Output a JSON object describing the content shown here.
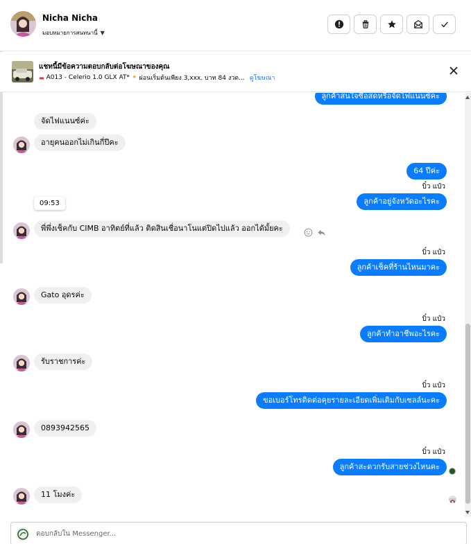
{
  "header": {
    "contact_name": "Nicha Nicha",
    "assign_label": "มอบหมายการสนทนานี้",
    "actions": [
      "report-icon",
      "trash-icon",
      "star-icon",
      "mark-unread-icon",
      "done-check-icon"
    ]
  },
  "ad_banner": {
    "title": "แชทนี้มีข้อความตอบกลับต่อโฆษณาของคุณ",
    "description": "A013 - Celerio 1.0 GLX AT* ",
    "description_after": "ผ่อนเริ่มต้นเพียง 3,xxx. บาท 84 งวด...",
    "link": "ดูโฆษณา"
  },
  "conversation": {
    "messages": [
      {
        "dir": "out",
        "text": "ลูกค้าสนใจซื้อสดหรือจัดไฟแนนซ์คะ"
      },
      {
        "dir": "in",
        "text": "จัดไฟแนนซ์ค่ะ"
      },
      {
        "dir": "in",
        "text": "อายุคนออกไม่เกินกี่ปีคะ"
      },
      {
        "dir": "out",
        "text": "64 ปีค่ะ"
      },
      {
        "dir": "out",
        "text": "ลูกค้าอยู่จังหวัดอะไรคะ",
        "seen": "บิ๋ว แป๋ว"
      },
      {
        "dir": "in",
        "text": "พี่พึ่งเช็คกับ CIMB อาทิตย์ที่แล้ว ติดสินเชื่อนาโนแต่ปิดไปแล้ว ออกได้มั้ยคะ"
      },
      {
        "dir": "out",
        "text": "ลูกค้าเช็คที่ร้านไหนมาคะ",
        "seen": "บิ๋ว แป๋ว"
      },
      {
        "dir": "in",
        "text": "Gato อุดรค่ะ"
      },
      {
        "dir": "out",
        "text": "ลูกค้าทำอาชีพอะไรคะ",
        "seen": "บิ๋ว แป๋ว"
      },
      {
        "dir": "in",
        "text": "รับราชการค่ะ"
      },
      {
        "dir": "out",
        "text": "ขอเบอร์โทรติดต่อคุยรายละเอียดเพิ่มเติมกับเซลล์นะคะ",
        "seen": "บิ๋ว แป๋ว"
      },
      {
        "dir": "in",
        "text": "0893942565"
      },
      {
        "dir": "out",
        "text": "ลูกค้าสะดวกรับสายช่วงไหนคะ",
        "seen": "บิ๋ว แป๋ว"
      },
      {
        "dir": "in",
        "text": "11 โมงค่ะ"
      }
    ],
    "time_chip": "09:53"
  },
  "reply": {
    "placeholder": "ตอบกลับใน Messenger..."
  },
  "colors": {
    "outgoing_bubble": "#0a7cff",
    "incoming_bubble": "#f0f0f0",
    "link": "#1877f2"
  }
}
